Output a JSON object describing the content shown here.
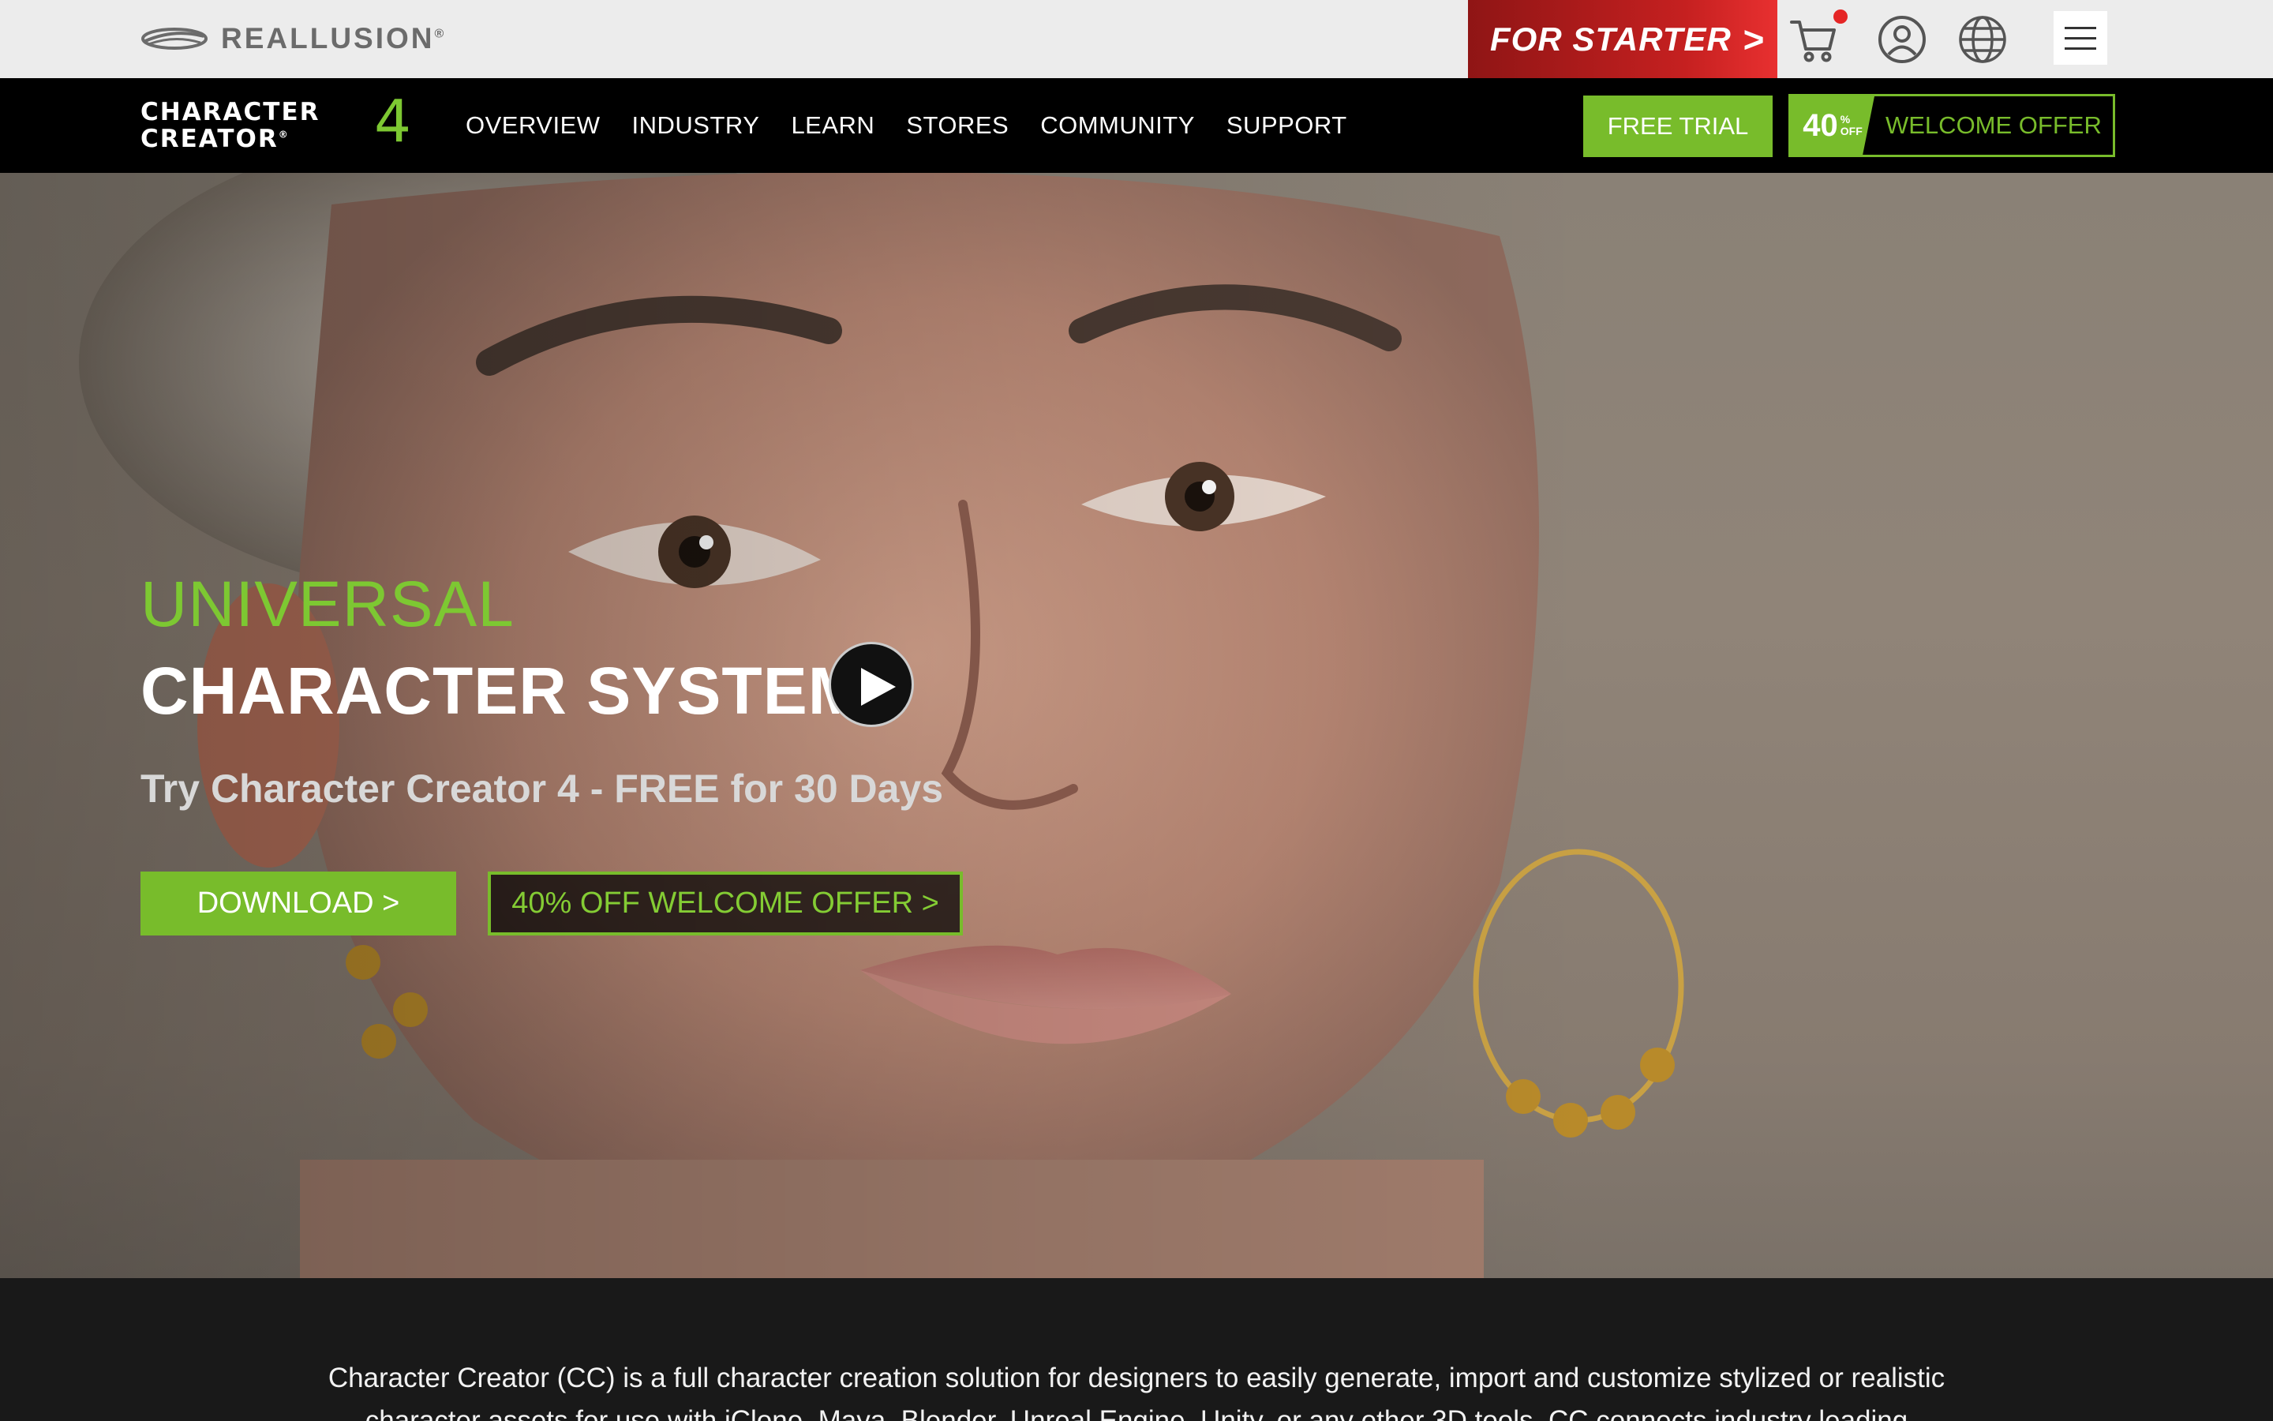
{
  "topbar": {
    "brand": "REALLUSION",
    "brand_mark": "®",
    "starter_label": "FOR STARTER",
    "starter_chevron": ">",
    "icons": [
      "cart-icon",
      "user-icon",
      "globe-icon",
      "menu-icon"
    ],
    "cart_has_notification": true
  },
  "nav": {
    "logo_line1": "CHARACTER",
    "logo_line2": "CREATOR",
    "logo_mark": "®",
    "logo_version": "4",
    "links": [
      "OVERVIEW",
      "INDUSTRY",
      "LEARN",
      "STORES",
      "COMMUNITY",
      "SUPPORT"
    ],
    "free_trial": "FREE TRIAL",
    "offer_badge_num": "40",
    "offer_badge_pct": "%",
    "offer_badge_off": "OFF",
    "offer_label": "WELCOME OFFER"
  },
  "hero": {
    "eyebrow": "UNIVERSAL",
    "title": "CHARACTER SYSTEM",
    "subtitle": "Try Character Creator 4 - FREE for 30 Days",
    "download_label": "DOWNLOAD >",
    "offer_label": "40% OFF WELCOME OFFER >"
  },
  "intro": {
    "text": "Character Creator (CC) is a full character creation solution for designers to easily generate, import and customize stylized or realistic character assets for use with iClone, Maya, Blender, Unreal Engine, Unity, or any other 3D tools. CC connects industry leading"
  },
  "colors": {
    "accent_green": "#78bc2b",
    "starter_red": "#c52020",
    "nav_bg": "#000000",
    "topbar_bg": "#ececec",
    "intro_bg": "#191919"
  }
}
